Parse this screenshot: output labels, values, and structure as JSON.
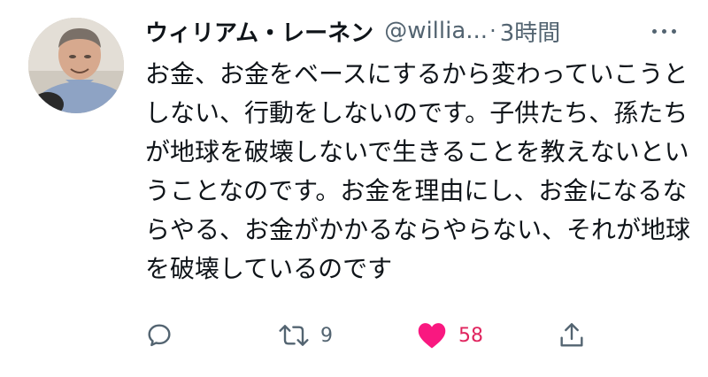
{
  "tweet": {
    "display_name": "ウィリアム・レーネン",
    "handle": "@willia...",
    "separator": "·",
    "time": "3時間",
    "body": "お金、お金をベースにするから変わっていこうとしない、行動をしないのです。子供たち、孫たちが地球を破壊しないで生きることを教えないということなのです。お金を理由にし、お金になるならやる、お金がかかるならやらない、それが地球を破壊しているのです"
  },
  "actions": {
    "reply": {
      "icon": "reply-icon"
    },
    "retweet": {
      "icon": "retweet-icon",
      "count": "9"
    },
    "like": {
      "icon": "heart-icon",
      "count": "58",
      "active": true,
      "color": "#e0245e"
    },
    "share": {
      "icon": "share-icon"
    }
  },
  "colors": {
    "text": "#0f1419",
    "secondary": "#536471",
    "like": "#e0245e"
  }
}
